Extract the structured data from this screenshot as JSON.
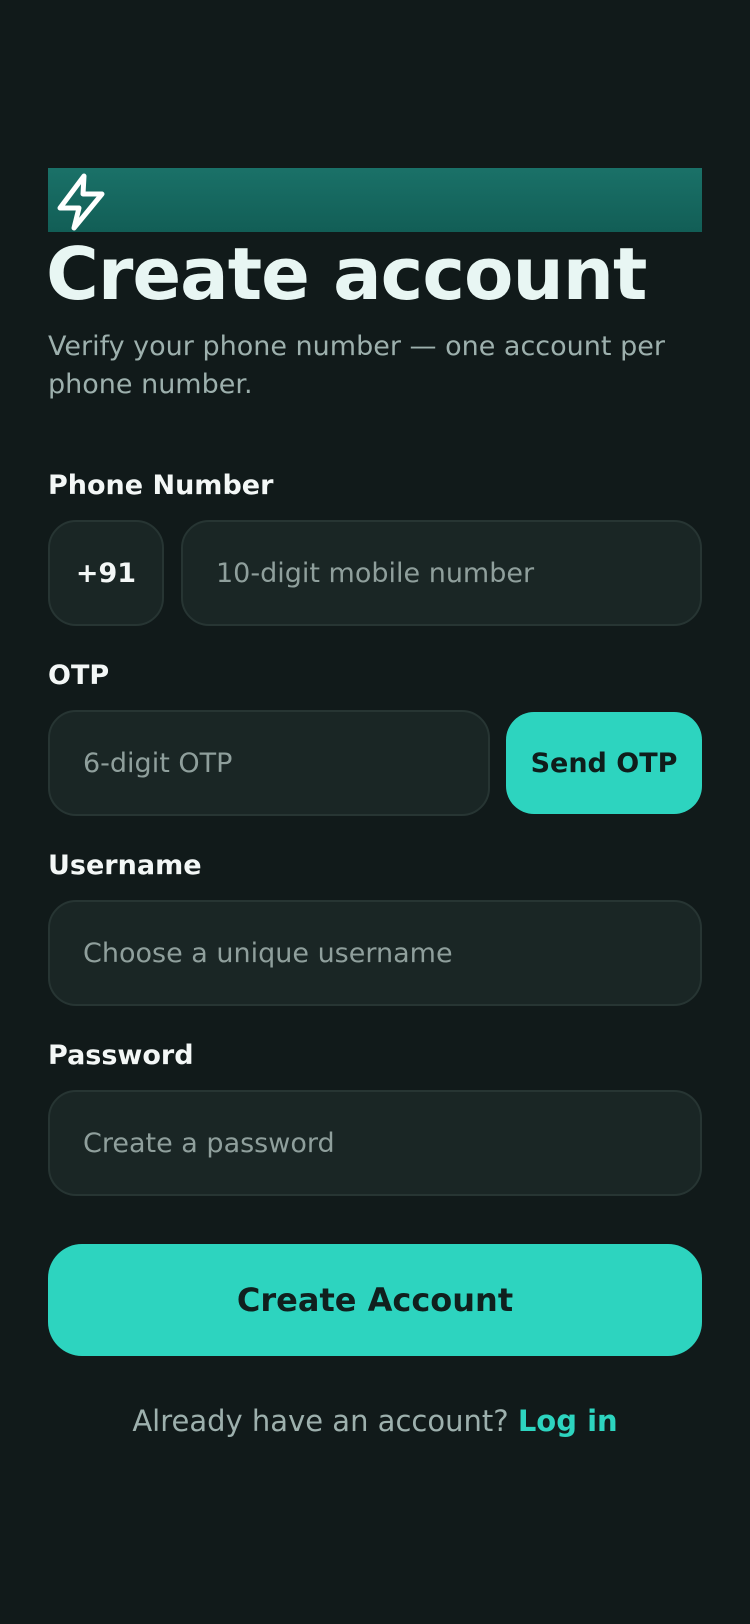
{
  "brand": {
    "icon": "bolt-icon",
    "colors": {
      "accent": "#2dd4bf",
      "banner": "#156a61",
      "background": "#111a1a"
    }
  },
  "header": {
    "title": "Create account",
    "subtitle": "Verify your phone number — one account per phone number."
  },
  "phone": {
    "label": "Phone Number",
    "country_code": "+91",
    "placeholder": "10-digit mobile number"
  },
  "otp": {
    "label": "OTP",
    "placeholder": "6-digit OTP",
    "send_label": "Send OTP"
  },
  "username": {
    "label": "Username",
    "placeholder": "Choose a unique username"
  },
  "password": {
    "label": "Password",
    "placeholder": "Create a password"
  },
  "submit": {
    "label": "Create Account"
  },
  "footer": {
    "prompt": "Already have an account?",
    "link_label": "Log in"
  }
}
